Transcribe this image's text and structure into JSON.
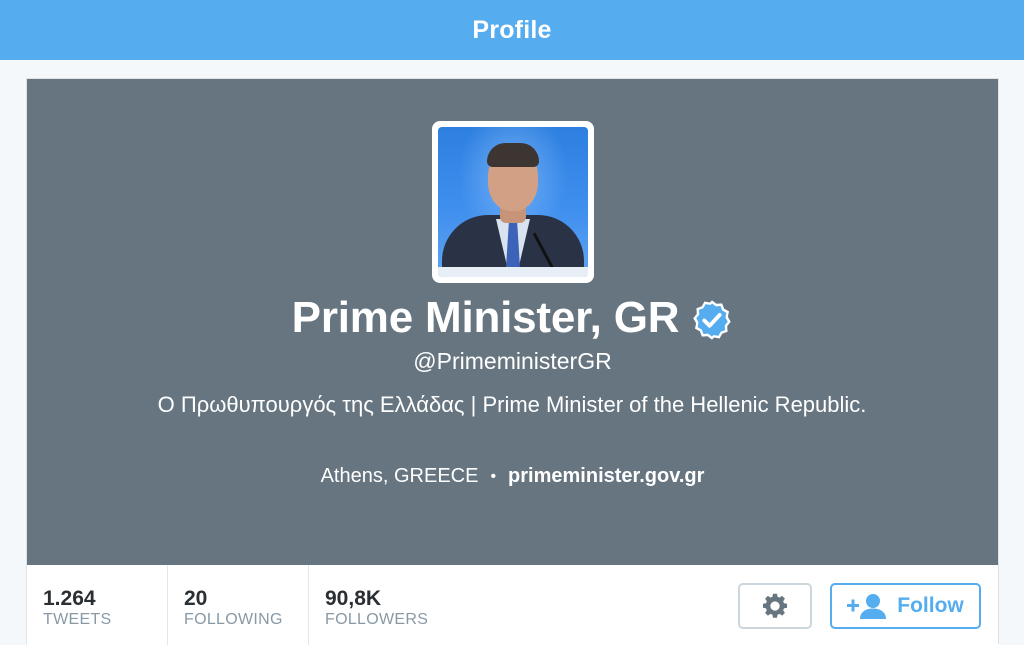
{
  "header": {
    "title": "Profile"
  },
  "profile": {
    "name": "Prime Minister, GR",
    "verified": true,
    "handle": "@PrimeministerGR",
    "bio": "Ο Πρωθυπουργός της Ελλάδας | Prime Minister of the Hellenic Republic.",
    "location": "Athens, GREECE",
    "separator": "•",
    "url": "primeminister.gov.gr"
  },
  "stats": [
    {
      "value": "1.264",
      "label": "TWEETS"
    },
    {
      "value": "20",
      "label": "FOLLOWING"
    },
    {
      "value": "90,8K",
      "label": "FOLLOWERS"
    }
  ],
  "actions": {
    "settings_icon": "gear-icon",
    "follow_icon": "add-user-icon",
    "follow_label": "Follow"
  },
  "colors": {
    "header_bg": "#55acee",
    "banner_bg": "#66757f",
    "accent": "#55acee",
    "verified": "#55acee"
  }
}
